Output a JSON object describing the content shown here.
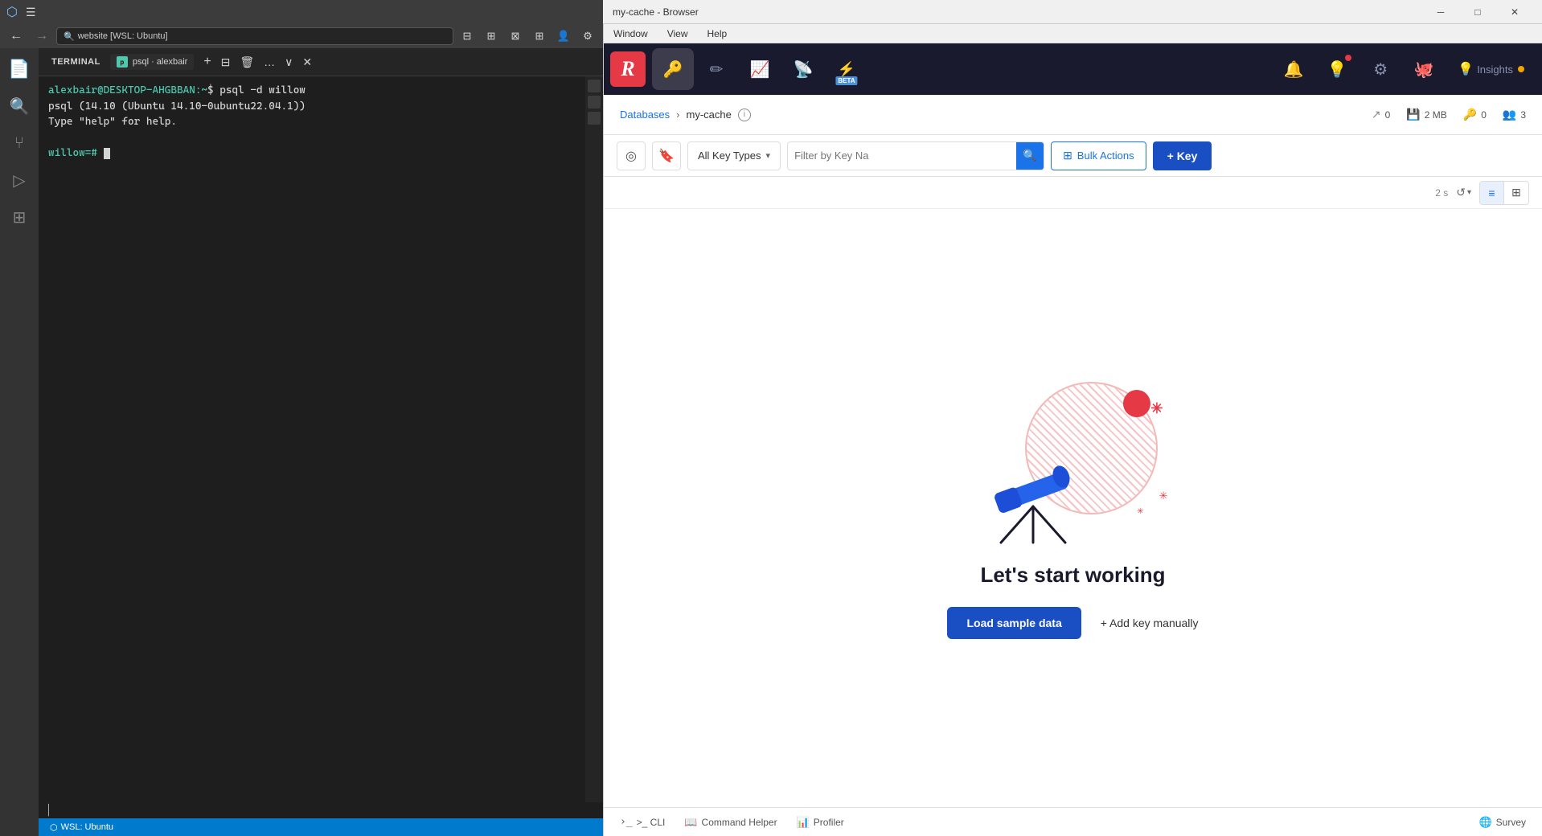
{
  "vscode": {
    "titlebar": {
      "title": "my-cache - Browser",
      "window_button_minimize": "─",
      "window_button_maximize": "□",
      "window_button_close": "✕"
    },
    "topbar": {
      "back_label": "←",
      "forward_label": "→",
      "address": "website [WSL: Ubuntu]",
      "layout_icons": [
        "⊟",
        "⊞",
        "⊠",
        "⊞"
      ],
      "user_icon": "👤",
      "settings_icon": "⚙"
    },
    "terminal": {
      "tab_label": "TERMINAL",
      "session_label": "psql · alexbair",
      "lines": [
        {
          "prefix": "alexbair@DESKTOP-AHGBBAN:~$ ",
          "user": "alexbair@DESKTOP-AHGBBAN",
          "separator": ":~",
          "cmd": "$ psql -d willow"
        },
        {
          "text": "psql (14.10 (Ubuntu 14.10-0ubuntu22.04.1))"
        },
        {
          "text": "Type \"help\" for help."
        },
        {
          "text": ""
        },
        {
          "prompt": "willow=#",
          "cursor": true
        }
      ]
    },
    "statusbar": {
      "remote": "WSL: Ubuntu"
    }
  },
  "redis": {
    "titlebar": {
      "title": "my-cache - Browser",
      "menu": [
        "Window",
        "View",
        "Help"
      ]
    },
    "nav": {
      "logo": "R",
      "icons": [
        {
          "name": "databases",
          "symbol": "🔑",
          "active": true
        },
        {
          "name": "edit",
          "symbol": "✏"
        },
        {
          "name": "analytics",
          "symbol": "📈"
        },
        {
          "name": "pubsub",
          "symbol": "📡"
        },
        {
          "name": "slowlog",
          "symbol": "⚡",
          "beta": true
        },
        {
          "name": "notifications",
          "symbol": "🔔"
        },
        {
          "name": "tips",
          "symbol": "💡"
        },
        {
          "name": "settings",
          "symbol": "⚙"
        },
        {
          "name": "github",
          "symbol": "🐙"
        }
      ],
      "insights_label": "Insights"
    },
    "breadcrumb": {
      "databases_label": "Databases",
      "separator": "›",
      "current": "my-cache",
      "stats": [
        {
          "icon": "↗",
          "value": "0"
        },
        {
          "icon": "💾",
          "value": "2 MB"
        },
        {
          "icon": "🔑",
          "value": "0"
        },
        {
          "icon": "👥",
          "value": "3"
        }
      ]
    },
    "toolbar": {
      "filter_icon": "◎",
      "bookmark_icon": "🔖",
      "key_types_label": "All Key Types",
      "filter_placeholder": "Filter by Key Na",
      "bulk_actions_label": "Bulk Actions",
      "add_key_label": "+ Key"
    },
    "list_header": {
      "time_label": "2 s",
      "refresh_icon": "↺"
    },
    "empty_state": {
      "title": "Let's start working",
      "load_sample_label": "Load sample data",
      "add_key_label": "+ Add key manually"
    },
    "bottombar": {
      "cli_label": ">_ CLI",
      "command_helper_label": "Command Helper",
      "profiler_label": "Profiler",
      "survey_label": "Survey"
    }
  }
}
